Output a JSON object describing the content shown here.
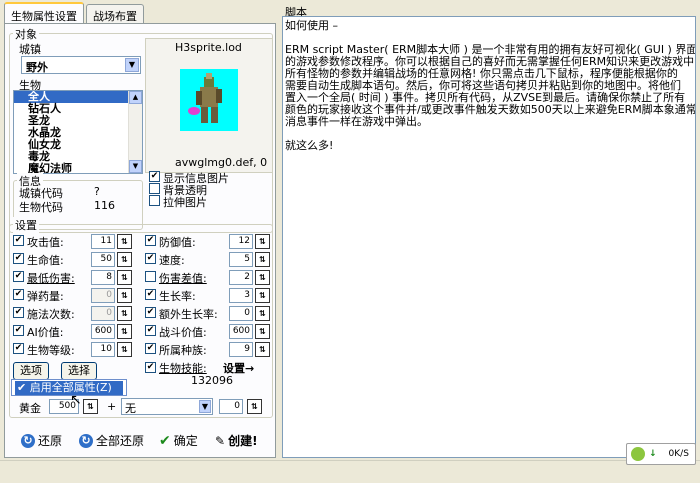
{
  "tabs": [
    {
      "label": "生物属性设置"
    },
    {
      "label": "战场布置"
    }
  ],
  "object_group": {
    "title": "对象",
    "town_label": "城镇",
    "town_value": "野外",
    "creature_label": "生物",
    "creatures": [
      "全人",
      "钻石人",
      "圣龙",
      "水晶龙",
      "仙女龙",
      "毒龙",
      "魔幻法师"
    ],
    "selected_index": 0,
    "sprite_file": "H3sprite.lod",
    "def_file": "avwglmg0.def, 0"
  },
  "info_group": {
    "title": "信息",
    "town_code_label": "城镇代码",
    "town_code_value": "?",
    "creature_code_label": "生物代码",
    "creature_code_value": "116"
  },
  "display_options": [
    {
      "label": "显示信息图片",
      "checked": true
    },
    {
      "label": "背景透明",
      "checked": false
    },
    {
      "label": "拉伸图片",
      "checked": false
    }
  ],
  "settings": {
    "title": "设置",
    "left_fields": [
      {
        "label": "攻击值:",
        "value": "11",
        "checked": true,
        "underline": false,
        "disabled": false
      },
      {
        "label": "生命值:",
        "value": "50",
        "checked": true,
        "underline": false,
        "disabled": false
      },
      {
        "label": "最低伤害:",
        "value": "8",
        "checked": true,
        "underline": true,
        "disabled": false
      },
      {
        "label": "弹药量:",
        "value": "0",
        "checked": true,
        "underline": false,
        "disabled": true
      },
      {
        "label": "施法次数:",
        "value": "0",
        "checked": true,
        "underline": false,
        "disabled": true
      },
      {
        "label": "AI价值:",
        "value": "600",
        "checked": true,
        "underline": false,
        "disabled": false
      },
      {
        "label": "生物等级:",
        "value": "10",
        "checked": true,
        "underline": false,
        "disabled": false
      }
    ],
    "right_fields": [
      {
        "label": "防御值:",
        "value": "12",
        "checked": true,
        "underline": false
      },
      {
        "label": "速度:",
        "value": "5",
        "checked": true,
        "underline": false
      },
      {
        "label": "伤害差值:",
        "value": "2",
        "checked": false,
        "underline": true
      },
      {
        "label": "生长率:",
        "value": "3",
        "checked": true,
        "underline": false
      },
      {
        "label": "额外生长率:",
        "value": "0",
        "checked": true,
        "underline": false
      },
      {
        "label": "战斗价值:",
        "value": "600",
        "checked": true,
        "underline": false
      },
      {
        "label": "所属种族:",
        "value": "9",
        "checked": true,
        "underline": false
      }
    ],
    "skill_label": "生物技能:",
    "skill_setting": "设置→",
    "skill_code": "132096",
    "options_button": "选项",
    "choose_button": "选择",
    "popup_item": "启用全部属性(Z)",
    "gold_label": "黄金",
    "gold_value": "500",
    "plus": "+",
    "resource_value": "无",
    "resource_amount": "0"
  },
  "bottom_buttons": {
    "restore": "还原",
    "restore_all": "全部还原",
    "confirm": "确定",
    "create": "创建!"
  },
  "script_panel": {
    "title": "脚本",
    "lines": [
      "如何使用 –",
      "",
      "ERM script Master( ERM脚本大师 ) 是一个非常有用的拥有友好可视化( GUI ) 界面",
      "的游戏参数修改程序。你可以根据自己的喜好而无需掌握任何ERM知识来更改游戏中",
      "所有怪物的参数并编辑战场的任意网格! 你只需点击几下鼠标，程序便能根据你的",
      "需要自动生成脚本语句。然后，你可将这些语句拷贝并粘贴到你的地图中。将他们",
      "置入一个全局( 时间 ) 事件。拷贝所有代码，从ZVSE到最后。请确保你禁止了所有",
      "颜色的玩家接收这个事件并/或更改事件触发天数如500天以上来避免ERM脚本象通常",
      "消息事件一样在游戏中弹出。",
      "",
      "就这么多!"
    ]
  },
  "status": {
    "speed": "0K/S"
  },
  "colors": {
    "selection": "#316ac5",
    "sprite_bg": "#00ffff",
    "window_bg": "#ece9d8"
  }
}
